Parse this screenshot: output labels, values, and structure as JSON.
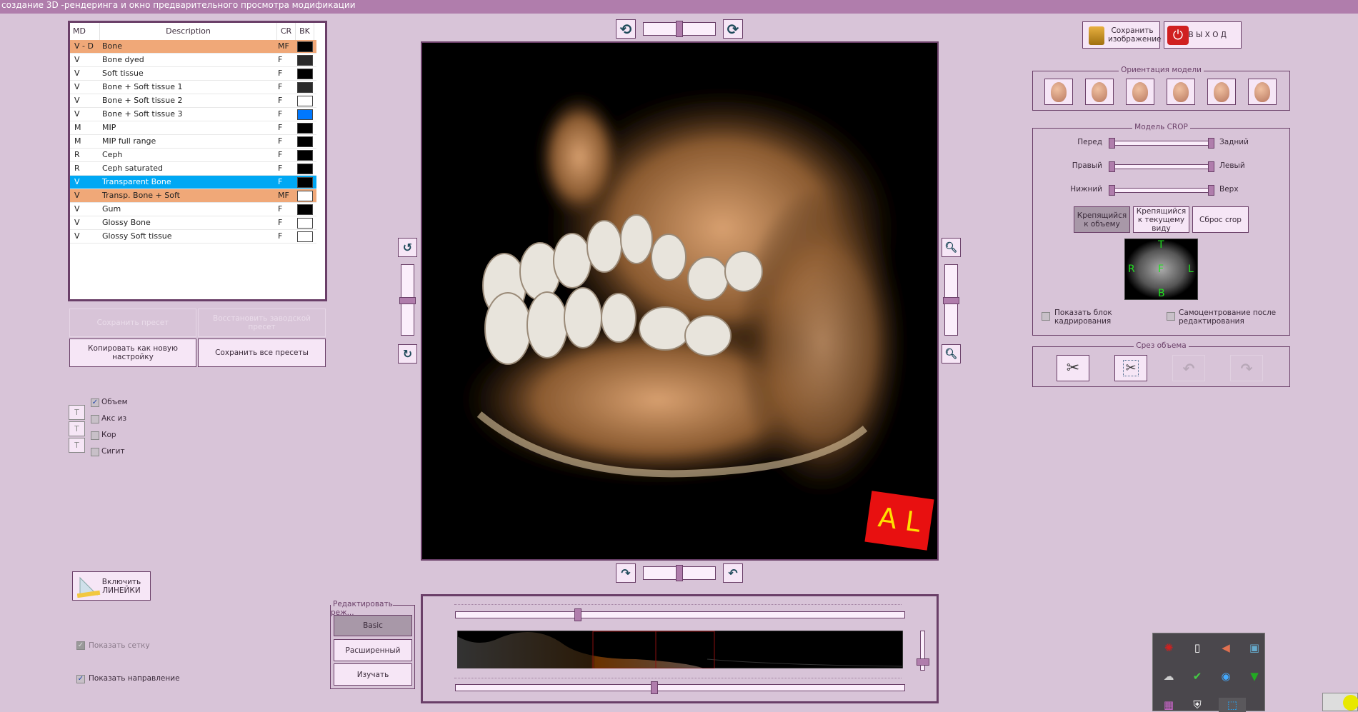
{
  "window": {
    "title": "создание 3D -рендеринга и окно предварительного просмотра модификации"
  },
  "presets": {
    "columns": [
      "MD",
      "Description",
      "CR",
      "BK"
    ],
    "rows": [
      {
        "md": "V - D",
        "desc": "Bone",
        "cr": "MF",
        "bk": "#000000",
        "state": "active"
      },
      {
        "md": "V",
        "desc": "Bone dyed",
        "cr": "F",
        "bk": "#2a2a2a"
      },
      {
        "md": "V",
        "desc": "Soft tissue",
        "cr": "F",
        "bk": "#000000"
      },
      {
        "md": "V",
        "desc": "Bone + Soft tissue 1",
        "cr": "F",
        "bk": "#2a2a2a"
      },
      {
        "md": "V",
        "desc": "Bone + Soft tissue 2",
        "cr": "F",
        "bk": "#ffffff"
      },
      {
        "md": "V",
        "desc": "Bone + Soft tissue 3",
        "cr": "F",
        "bk": "#0078ff"
      },
      {
        "md": "M",
        "desc": "MIP",
        "cr": "F",
        "bk": "#000000"
      },
      {
        "md": "M",
        "desc": "MIP full range",
        "cr": "F",
        "bk": "#000000"
      },
      {
        "md": "R",
        "desc": "Ceph",
        "cr": "F",
        "bk": "#000000"
      },
      {
        "md": "R",
        "desc": "Ceph saturated",
        "cr": "F",
        "bk": "#000000"
      },
      {
        "md": "V",
        "desc": "Transparent Bone",
        "cr": "F",
        "bk": "#000000",
        "state": "selected"
      },
      {
        "md": "V",
        "desc": "Transp. Bone + Soft",
        "cr": "MF",
        "bk": "#ffffff",
        "state": "active"
      },
      {
        "md": "V",
        "desc": "Gum",
        "cr": "F",
        "bk": "#000000"
      },
      {
        "md": "V",
        "desc": "Glossy Bone",
        "cr": "F",
        "bk": "#ffffff"
      },
      {
        "md": "V",
        "desc": "Glossy Soft tissue",
        "cr": "F",
        "bk": "#ffffff"
      }
    ],
    "save_preset": "Сохранить пресет",
    "restore_factory": "Восстановить заводской пресет",
    "copy_new": "Копировать как новую настройку",
    "save_all": "Сохранить все пресеты"
  },
  "views": {
    "volume": {
      "label": "Объем",
      "checked": true
    },
    "axial": {
      "label": "Акс из",
      "checked": false,
      "t": "T"
    },
    "coronal": {
      "label": "Кор",
      "checked": false,
      "t": "T"
    },
    "sagittal": {
      "label": "Сигит",
      "checked": false,
      "t": "T"
    }
  },
  "rulers": {
    "button": "Включить ЛИНЕЙКИ",
    "show_grid": {
      "label": "Показать сетку",
      "checked": true,
      "disabled": true
    },
    "show_direction": {
      "label": "Показать направление",
      "checked": true
    }
  },
  "viewport": {
    "cube_label": "A L",
    "top_rotation": 0.5,
    "bottom_rotation": 0.5,
    "left_tilt": 0.5,
    "zoom": 0.5
  },
  "edit_mode": {
    "title": "Редактировать реж...",
    "modes": [
      "Basic",
      "Расширенный",
      "Изучать"
    ],
    "selected": "Basic"
  },
  "transfer": {
    "top_slider": 0.27,
    "bottom_slider": 0.44,
    "opacity_slider": 0.2
  },
  "header_buttons": {
    "save_image": "Сохранить изображение",
    "exit": "В Ы Х О Д"
  },
  "orientation": {
    "title": "Ориентация модели",
    "views": [
      "front",
      "back",
      "right",
      "left",
      "top",
      "bottom"
    ]
  },
  "crop": {
    "title": "Модель CROP",
    "rows": [
      {
        "left": "Перед",
        "right": "Задний"
      },
      {
        "left": "Правый",
        "right": "Левый"
      },
      {
        "left": "Нижний",
        "right": "Верх"
      }
    ],
    "attach_volume": "Крепящийся к объему",
    "attach_view": "Крепящийся к текущему виду",
    "reset": "Сброс crop",
    "labels": {
      "t": "T",
      "b": "B",
      "r": "R",
      "l": "L",
      "f": "F"
    },
    "show_crop_box": {
      "label": "Показать блок кадрирования",
      "checked": false
    },
    "autocenter": {
      "label": "Самоцентрование после редактирования",
      "checked": false
    }
  },
  "cut": {
    "title": "Срез объема",
    "tools": [
      "scissors",
      "box-scissors",
      "undo",
      "redo"
    ]
  }
}
